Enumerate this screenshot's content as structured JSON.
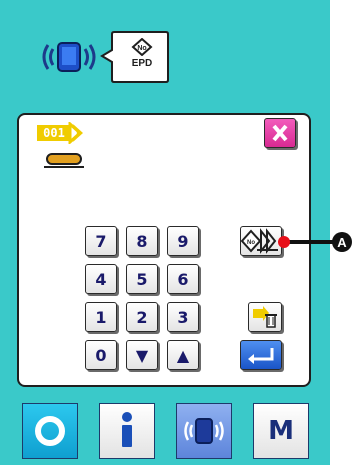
{
  "header": {
    "status_icon": "wireless-communication-icon",
    "mode_button_label": "EPD",
    "mode_button_icon": "no-epd-icon"
  },
  "panel": {
    "data_no_tag": "001",
    "close_icon": "close-x-icon",
    "keypad": {
      "rows": [
        [
          "7",
          "8",
          "9"
        ],
        [
          "4",
          "5",
          "6"
        ],
        [
          "1",
          "2",
          "3"
        ],
        [
          "0",
          "▼",
          "▲"
        ]
      ]
    },
    "side_icons": [
      "data-no-select-icon",
      "delete-data-icon",
      "enter-icon"
    ],
    "callout_label": "A"
  },
  "bottom_bar": {
    "buttons": [
      {
        "name": "ready-button",
        "icon": "ready-ring-icon"
      },
      {
        "name": "info-button",
        "icon": "info-i-icon"
      },
      {
        "name": "communication-button",
        "icon": "wireless-communication-icon"
      },
      {
        "name": "mode-button",
        "label": "M"
      }
    ]
  },
  "colors": {
    "background": "#3ac9c9",
    "panel": "#ffffff",
    "accent_blue": "#1d5ad6",
    "close_magenta": "#e83aa6",
    "tag_yellow": "#f0cc00",
    "callout_red": "#e8101a"
  }
}
